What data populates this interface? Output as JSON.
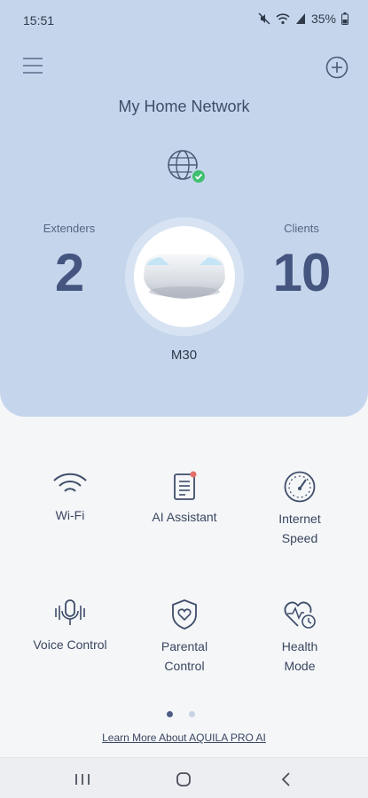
{
  "status_bar": {
    "time": "15:51",
    "battery": "35%",
    "icons": [
      "mute-icon",
      "wifi-icon",
      "signal-icon",
      "battery-icon"
    ]
  },
  "header": {
    "title": "My Home Network",
    "menu_icon": "hamburger-menu-icon",
    "add_icon": "add-circle-icon",
    "internet_status_icon": "globe-check-icon"
  },
  "stats": {
    "extenders_label": "Extenders",
    "extenders_value": "2",
    "clients_label": "Clients",
    "clients_value": "10"
  },
  "device": {
    "name": "M30"
  },
  "tiles": [
    {
      "label": "Wi-Fi",
      "icon": "wifi-icon"
    },
    {
      "label": "AI Assistant",
      "icon": "ai-assistant-icon"
    },
    {
      "label": "Internet\nSpeed",
      "icon": "speedometer-icon"
    },
    {
      "label": "Voice Control",
      "icon": "microphone-icon"
    },
    {
      "label": "Parental\nControl",
      "icon": "shield-heart-icon"
    },
    {
      "label": "Health\nMode",
      "icon": "heart-clock-icon"
    }
  ],
  "tile_labels": {
    "wifi": "Wi-Fi",
    "ai_assistant": "AI Assistant",
    "internet_speed_line1": "Internet",
    "internet_speed_line2": "Speed",
    "voice_control": "Voice Control",
    "parental_line1": "Parental",
    "parental_line2": "Control",
    "health_line1": "Health",
    "health_line2": "Mode"
  },
  "pager": {
    "current_page": 1,
    "total_pages": 2
  },
  "footer": {
    "learn_more": "Learn More About AQUILA PRO AI"
  },
  "colors": {
    "header_bg": "#c5d6ec",
    "accent": "#445580",
    "check_green": "#3fbf6f",
    "notification_dot": "#e5706a"
  }
}
